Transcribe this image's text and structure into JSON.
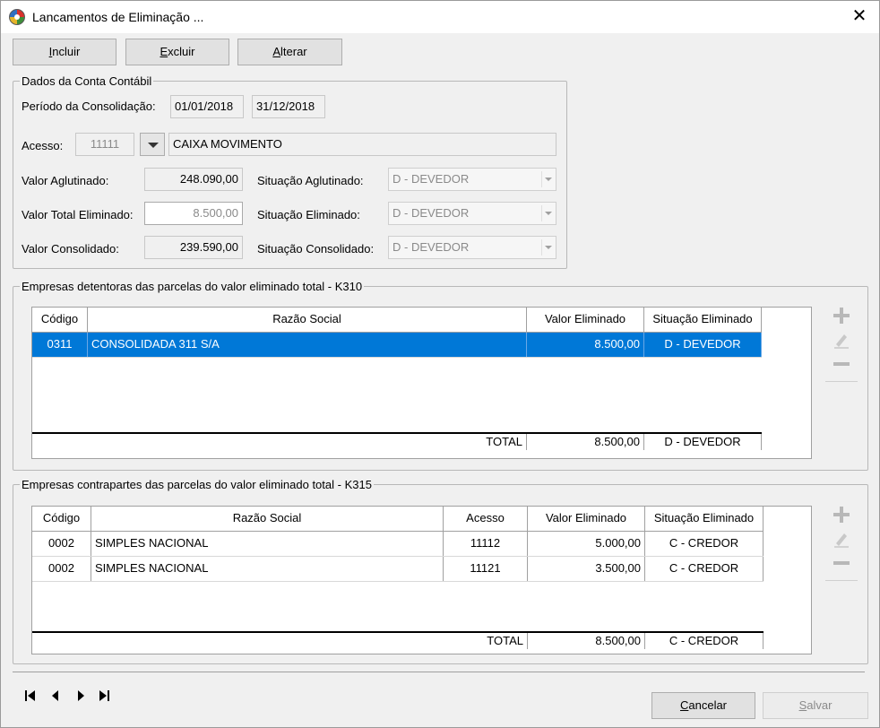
{
  "window": {
    "title": "Lancamentos de Eliminação ...",
    "close_label": "✕"
  },
  "toolbar": {
    "incluir": {
      "u": "I",
      "rest": "ncluir"
    },
    "excluir": {
      "u": "E",
      "rest": "xcluir"
    },
    "alterar": {
      "u": "A",
      "rest": "lterar"
    }
  },
  "dados": {
    "title": "Dados da Conta Contábil",
    "periodo_label": "Período da Consolidação:",
    "periodo_ini": "01/01/2018",
    "periodo_fim": "31/12/2018",
    "acesso_label": "Acesso:",
    "acesso_value": "11111",
    "acesso_desc": "CAIXA MOVIMENTO",
    "valor_aglutinado_label": "Valor Aglutinado:",
    "valor_aglutinado": "248.090,00",
    "situacao_aglutinado_label": "Situação Aglutinado:",
    "situacao_aglutinado": "D - DEVEDOR",
    "valor_total_eliminado_label": "Valor Total Eliminado:",
    "valor_total_eliminado": "8.500,00",
    "situacao_eliminado_label": "Situação Eliminado:",
    "situacao_eliminado": "D - DEVEDOR",
    "valor_consolidado_label": "Valor Consolidado:",
    "valor_consolidado": "239.590,00",
    "situacao_consolidado_label": "Situação Consolidado:",
    "situacao_consolidado": "D - DEVEDOR"
  },
  "k310": {
    "title": "Empresas detentoras das parcelas do valor eliminado total - K310",
    "headers": [
      "Código",
      "Razão Social",
      "Valor Eliminado",
      "Situação Eliminado"
    ],
    "rows": [
      {
        "codigo": "0311",
        "razao": "CONSOLIDADA 311 S/A",
        "valor": "8.500,00",
        "situacao": "D - DEVEDOR"
      }
    ],
    "total_label": "TOTAL",
    "total_valor": "8.500,00",
    "total_situacao": "D - DEVEDOR"
  },
  "k315": {
    "title": "Empresas contrapartes das parcelas do valor eliminado total - K315",
    "headers": [
      "Código",
      "Razão Social",
      "Acesso",
      "Valor Eliminado",
      "Situação Eliminado"
    ],
    "rows": [
      {
        "codigo": "0002",
        "razao": "SIMPLES NACIONAL",
        "acesso": "11112",
        "valor": "5.000,00",
        "situacao": "C - CREDOR"
      },
      {
        "codigo": "0002",
        "razao": "SIMPLES NACIONAL",
        "acesso": "11121",
        "valor": "3.500,00",
        "situacao": "C - CREDOR"
      }
    ],
    "total_label": "TOTAL",
    "total_valor": "8.500,00",
    "total_situacao": "C - CREDOR"
  },
  "footer": {
    "cancelar": {
      "u": "C",
      "rest": "ancelar"
    },
    "salvar": {
      "u": "S",
      "rest": "alvar"
    }
  },
  "colors": {
    "selection": "#0078d7",
    "background": "#f0f0f0"
  }
}
